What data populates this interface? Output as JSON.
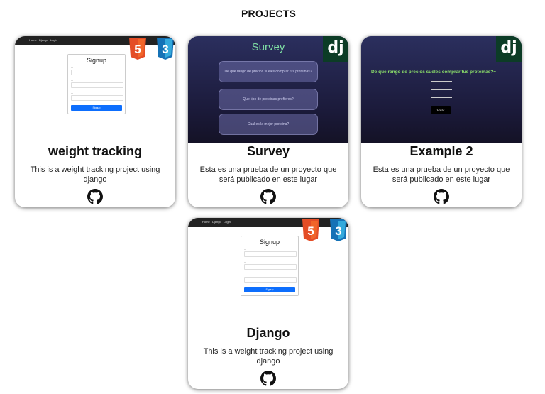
{
  "section": {
    "title": "PROJECTS"
  },
  "projects": [
    {
      "title": "weight tracking",
      "description": "This is a weight tracking project using django"
    },
    {
      "title": "Survey",
      "description": "Esta es una prueba de un proyecto que será publicado en este lugar"
    },
    {
      "title": "Example 2",
      "description": "Esta es una prueba de un proyecto que será publicado en este lugar"
    },
    {
      "title": "Django",
      "description": "This is a weight tracking project using django"
    }
  ],
  "thumbnails": {
    "signup": {
      "title": "Signup",
      "button": "Signup",
      "nav": [
        "Home",
        "Django",
        "Login"
      ]
    },
    "survey": {
      "title": "Survey",
      "options": [
        "De que rango de precios sueles comprar tus proteinas?",
        "Que tipo de proteinas prefieres?",
        "Cual es la mejor proteina?"
      ]
    },
    "example": {
      "question": "De que rango de precios sueles comprar tus proteinas?~",
      "button": "Votar"
    }
  },
  "icons": {
    "github": "github-icon",
    "html5": "html5-icon",
    "css3": "css3-icon",
    "django": "django-icon"
  },
  "colors": {
    "html5": "#e44d26",
    "css3": "#1572b6",
    "django": "#0c3c26",
    "survey_title": "#7fe0a4",
    "signup_button": "#0d6efd"
  }
}
